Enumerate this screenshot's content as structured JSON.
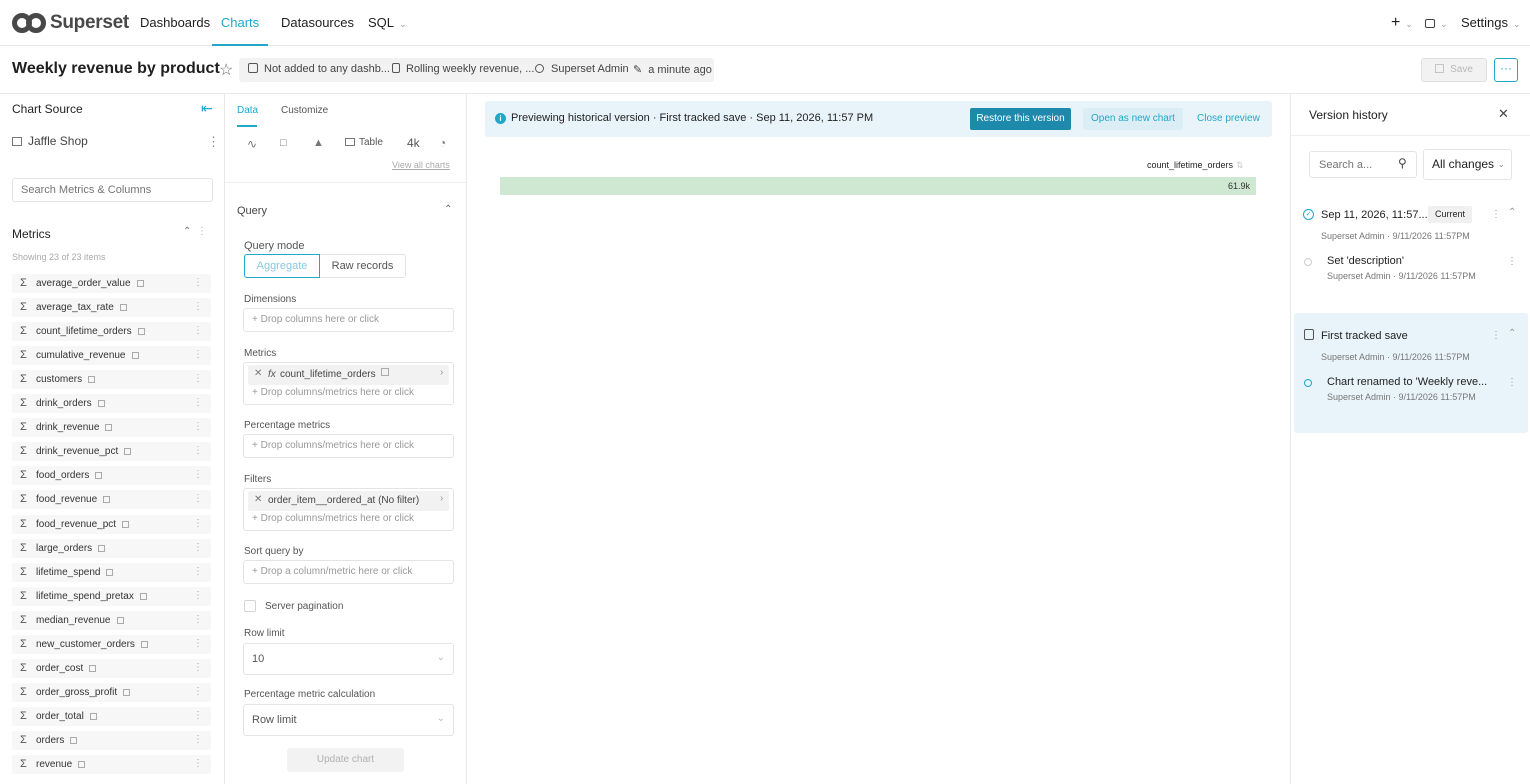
{
  "nav": {
    "brand": "Superset",
    "items": [
      "Dashboards",
      "Charts",
      "Datasources",
      "SQL"
    ],
    "plus": "+",
    "settings": "Settings"
  },
  "header": {
    "title": "Weekly revenue by product",
    "dashboards": "Not added to any dashb...",
    "dataset": "Rolling weekly revenue, ...",
    "owner": "Superset Admin",
    "modified": "a minute ago",
    "save": "Save",
    "more": "···"
  },
  "left": {
    "title": "Chart Source",
    "dataset": "Jaffle Shop",
    "search_placeholder": "Search Metrics & Columns",
    "metrics_title": "Metrics",
    "showing": "Showing 23 of 23 items",
    "metrics": [
      "average_order_value",
      "average_tax_rate",
      "count_lifetime_orders",
      "cumulative_revenue",
      "customers",
      "drink_orders",
      "drink_revenue",
      "drink_revenue_pct",
      "food_orders",
      "food_revenue",
      "food_revenue_pct",
      "large_orders",
      "lifetime_spend",
      "lifetime_spend_pretax",
      "median_revenue",
      "new_customer_orders",
      "order_cost",
      "order_gross_profit",
      "order_total",
      "orders",
      "revenue"
    ]
  },
  "control": {
    "tabs": [
      "Data",
      "Customize"
    ],
    "viz_table": "Table",
    "viz_4k": "4k",
    "view_all": "View all charts",
    "query_title": "Query",
    "query_mode_label": "Query mode",
    "mode_aggregate": "Aggregate",
    "mode_raw": "Raw records",
    "dimensions_label": "Dimensions",
    "drop_columns": "Drop columns here or click",
    "metrics_label": "Metrics",
    "metric_chip_fx": "fx",
    "metric_chip": "count_lifetime_orders",
    "drop_cols_metrics": "Drop columns/metrics here or click",
    "pct_metrics_label": "Percentage metrics",
    "filters_label": "Filters",
    "filter_chip": "order_item__ordered_at (No filter)",
    "sort_label": "Sort query by",
    "drop_sort": "Drop a column/metric here or click",
    "server_pagination": "Server pagination",
    "row_limit_label": "Row limit",
    "row_limit_value": "10",
    "pct_calc_label": "Percentage metric calculation",
    "pct_calc_value": "Row limit",
    "update": "Update chart"
  },
  "banner": {
    "text": "Previewing historical version · First tracked save · Sep 11, 2026, 11:57 PM",
    "restore": "Restore this version",
    "open_new": "Open as new chart",
    "close": "Close preview"
  },
  "table": {
    "header": "count_lifetime_orders",
    "value": "61.9k",
    "fill_fraction": 1.0
  },
  "history": {
    "title": "Version history",
    "search_placeholder": "Search a...",
    "filter": "All changes",
    "current": {
      "title": "Sep 11, 2026, 11:57...",
      "badge": "Current",
      "sub": "Superset Admin · 9/11/2026 11:57PM",
      "child_title": "Set 'description'",
      "child_sub": "Superset Admin · 9/11/2026 11:57PM"
    },
    "tracked": {
      "title": "First tracked save",
      "sub": "Superset Admin · 9/11/2026 11:57PM",
      "child_title": "Chart renamed to 'Weekly reve...",
      "child_sub": "Superset Admin · 9/11/2026 11:57PM"
    }
  },
  "colors": {
    "accent": "#20a7c9",
    "bar": "#cfe8d2",
    "banner_bg": "#e8f4fa"
  }
}
